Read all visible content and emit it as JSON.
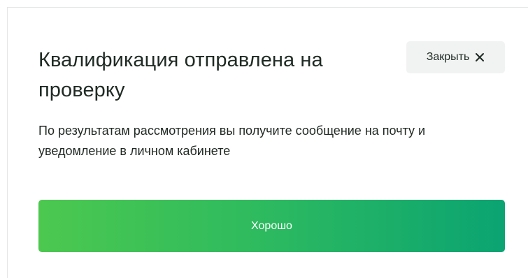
{
  "modal": {
    "title": "Квалификация отправлена на проверку",
    "close_label": "Закрыть",
    "close_icon": "close-icon",
    "description": "По результатам рассмотрения вы получите сообщение на почту и уведомление в личном кабинете",
    "ok_label": "Хорошо",
    "accent_gradient": [
      "#4cc84f",
      "#0ba472"
    ]
  }
}
